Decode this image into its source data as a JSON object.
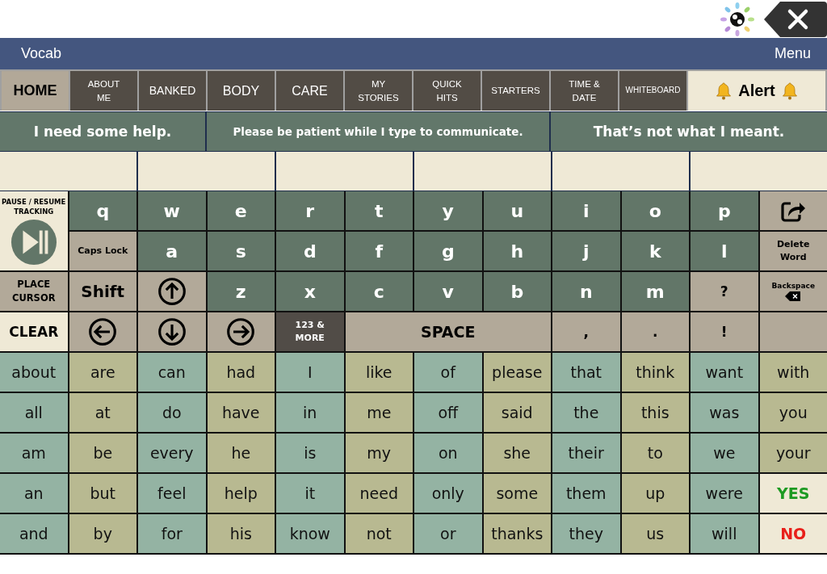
{
  "header": {
    "title": "Vocab",
    "menu": "Menu"
  },
  "tabs": [
    {
      "label": "HOME",
      "selected": true,
      "kind": "large"
    },
    {
      "label": "ABOUT ME",
      "selected": false,
      "kind": "small"
    },
    {
      "label": "BANKED",
      "selected": false,
      "kind": "medium"
    },
    {
      "label": "BODY",
      "selected": false,
      "kind": "large"
    },
    {
      "label": "CARE",
      "selected": false,
      "kind": "large"
    },
    {
      "label": "MY STORIES",
      "selected": false,
      "kind": "small"
    },
    {
      "label": "QUICK HITS",
      "selected": false,
      "kind": "small"
    },
    {
      "label": "STARTERS",
      "selected": false,
      "kind": "small"
    },
    {
      "label": "TIME & DATE",
      "selected": false,
      "kind": "small"
    },
    {
      "label": "WHITEBOARD",
      "selected": false,
      "kind": "tiny"
    },
    {
      "label": "Alert",
      "selected": false,
      "kind": "alert"
    }
  ],
  "phrases": [
    "I need some help.",
    "Please be patient while I type to communicate.",
    "That’s not what I meant."
  ],
  "keys": [
    {
      "kind": "pause",
      "label": "PAUSE / RESUME TRACKING"
    },
    {
      "kind": "letter",
      "label": "q"
    },
    {
      "kind": "letter",
      "label": "w"
    },
    {
      "kind": "letter",
      "label": "e"
    },
    {
      "kind": "letter",
      "label": "r"
    },
    {
      "kind": "letter",
      "label": "t"
    },
    {
      "kind": "letter",
      "label": "y"
    },
    {
      "kind": "letter",
      "label": "u"
    },
    {
      "kind": "letter",
      "label": "i"
    },
    {
      "kind": "letter",
      "label": "o"
    },
    {
      "kind": "letter",
      "label": "p"
    },
    {
      "kind": "share"
    },
    {
      "kind": "function",
      "label": "Caps Lock"
    },
    {
      "kind": "letter",
      "label": "a"
    },
    {
      "kind": "letter",
      "label": "s"
    },
    {
      "kind": "letter",
      "label": "d"
    },
    {
      "kind": "letter",
      "label": "f"
    },
    {
      "kind": "letter",
      "label": "g"
    },
    {
      "kind": "letter",
      "label": "h"
    },
    {
      "kind": "letter",
      "label": "j"
    },
    {
      "kind": "letter",
      "label": "k"
    },
    {
      "kind": "letter",
      "label": "l"
    },
    {
      "kind": "function",
      "label": "Delete Word"
    },
    {
      "kind": "action",
      "label": "PLACE CURSOR"
    },
    {
      "kind": "big",
      "label": "Shift"
    },
    {
      "kind": "up"
    },
    {
      "kind": "letter",
      "label": "z"
    },
    {
      "kind": "letter",
      "label": "x"
    },
    {
      "kind": "letter",
      "label": "c"
    },
    {
      "kind": "letter",
      "label": "v"
    },
    {
      "kind": "letter",
      "label": "b"
    },
    {
      "kind": "letter",
      "label": "n"
    },
    {
      "kind": "letter",
      "label": "m"
    },
    {
      "kind": "punct",
      "label": "?"
    },
    {
      "kind": "backspace",
      "label": "Backspace"
    },
    {
      "kind": "clear",
      "label": "CLEAR"
    },
    {
      "kind": "left"
    },
    {
      "kind": "down"
    },
    {
      "kind": "right"
    },
    {
      "kind": "more",
      "label": "123 & MORE"
    },
    {
      "kind": "space",
      "label": "SPACE"
    },
    {
      "kind": "punct",
      "label": ","
    },
    {
      "kind": "punct",
      "label": "."
    },
    {
      "kind": "punct",
      "label": "!"
    },
    {
      "kind": "empty"
    }
  ],
  "words": [
    [
      {
        "text": "about",
        "kind": "word",
        "color": "#94b3a3"
      },
      {
        "text": "are",
        "kind": "word",
        "color": "#b8b991"
      },
      {
        "text": "can",
        "kind": "word",
        "color": "#94b3a3"
      },
      {
        "text": "had",
        "kind": "word",
        "color": "#b8b991"
      },
      {
        "text": "I",
        "kind": "word",
        "color": "#94b3a3"
      },
      {
        "text": "like",
        "kind": "word",
        "color": "#b8b991"
      },
      {
        "text": "of",
        "kind": "word",
        "color": "#94b3a3"
      },
      {
        "text": "please",
        "kind": "word",
        "color": "#b8b991"
      },
      {
        "text": "that",
        "kind": "word",
        "color": "#94b3a3"
      },
      {
        "text": "think",
        "kind": "word",
        "color": "#b8b991"
      },
      {
        "text": "want",
        "kind": "word",
        "color": "#94b3a3"
      },
      {
        "text": "with",
        "kind": "word",
        "color": "#b8b991"
      }
    ],
    [
      {
        "text": "all",
        "kind": "word",
        "color": "#94b3a3"
      },
      {
        "text": "at",
        "kind": "word",
        "color": "#b8b991"
      },
      {
        "text": "do",
        "kind": "word",
        "color": "#94b3a3"
      },
      {
        "text": "have",
        "kind": "word",
        "color": "#b8b991"
      },
      {
        "text": "in",
        "kind": "word",
        "color": "#94b3a3"
      },
      {
        "text": "me",
        "kind": "word",
        "color": "#b8b991"
      },
      {
        "text": "off",
        "kind": "word",
        "color": "#94b3a3"
      },
      {
        "text": "said",
        "kind": "word",
        "color": "#b8b991"
      },
      {
        "text": "the",
        "kind": "word",
        "color": "#94b3a3"
      },
      {
        "text": "this",
        "kind": "word",
        "color": "#b8b991"
      },
      {
        "text": "was",
        "kind": "word",
        "color": "#94b3a3"
      },
      {
        "text": "you",
        "kind": "word",
        "color": "#b8b991"
      }
    ],
    [
      {
        "text": "am",
        "kind": "word",
        "color": "#94b3a3"
      },
      {
        "text": "be",
        "kind": "word",
        "color": "#b8b991"
      },
      {
        "text": "every",
        "kind": "word",
        "color": "#94b3a3"
      },
      {
        "text": "he",
        "kind": "word",
        "color": "#b8b991"
      },
      {
        "text": "is",
        "kind": "word",
        "color": "#94b3a3"
      },
      {
        "text": "my",
        "kind": "word",
        "color": "#b8b991"
      },
      {
        "text": "on",
        "kind": "word",
        "color": "#94b3a3"
      },
      {
        "text": "she",
        "kind": "word",
        "color": "#b8b991"
      },
      {
        "text": "their",
        "kind": "word",
        "color": "#94b3a3"
      },
      {
        "text": "to",
        "kind": "word",
        "color": "#b8b991"
      },
      {
        "text": "we",
        "kind": "word",
        "color": "#94b3a3"
      },
      {
        "text": "your",
        "kind": "word",
        "color": "#b8b991"
      }
    ],
    [
      {
        "text": "an",
        "kind": "word",
        "color": "#94b3a3"
      },
      {
        "text": "but",
        "kind": "word",
        "color": "#b8b991"
      },
      {
        "text": "feel",
        "kind": "word",
        "color": "#94b3a3"
      },
      {
        "text": "help",
        "kind": "word",
        "color": "#b8b991"
      },
      {
        "text": "it",
        "kind": "word",
        "color": "#94b3a3"
      },
      {
        "text": "need",
        "kind": "word",
        "color": "#b8b991"
      },
      {
        "text": "only",
        "kind": "word",
        "color": "#94b3a3"
      },
      {
        "text": "some",
        "kind": "word",
        "color": "#b8b991"
      },
      {
        "text": "them",
        "kind": "word",
        "color": "#94b3a3"
      },
      {
        "text": "up",
        "kind": "word",
        "color": "#b8b991"
      },
      {
        "text": "were",
        "kind": "word",
        "color": "#94b3a3"
      },
      {
        "text": "YES",
        "kind": "yes"
      }
    ],
    [
      {
        "text": "and",
        "kind": "word",
        "color": "#94b3a3"
      },
      {
        "text": "by",
        "kind": "word",
        "color": "#b8b991"
      },
      {
        "text": "for",
        "kind": "word",
        "color": "#94b3a3"
      },
      {
        "text": "his",
        "kind": "word",
        "color": "#b8b991"
      },
      {
        "text": "know",
        "kind": "word",
        "color": "#94b3a3"
      },
      {
        "text": "not",
        "kind": "word",
        "color": "#b8b991"
      },
      {
        "text": "or",
        "kind": "word",
        "color": "#94b3a3"
      },
      {
        "text": "thanks",
        "kind": "word",
        "color": "#b8b991"
      },
      {
        "text": "they",
        "kind": "word",
        "color": "#94b3a3"
      },
      {
        "text": "us",
        "kind": "word",
        "color": "#b8b991"
      },
      {
        "text": "will",
        "kind": "word",
        "color": "#94b3a3"
      },
      {
        "text": "NO",
        "kind": "no"
      }
    ]
  ]
}
